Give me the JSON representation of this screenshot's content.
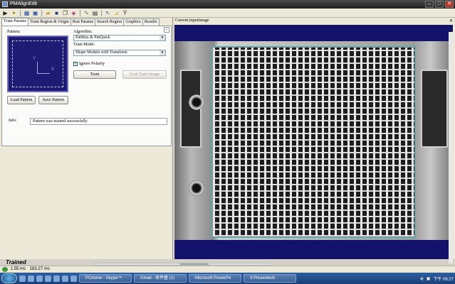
{
  "window": {
    "title": "PMAlignEdit",
    "minimize": "–",
    "maximize": "□",
    "close": "✕"
  },
  "toolbar": {
    "icons": [
      "play-icon",
      "magic-wand-icon",
      "grid-icon",
      "image-icon",
      "open-icon",
      "save-icon",
      "copy-icon",
      "layers-icon",
      "paint-icon",
      "text-icon",
      "cursor-icon",
      "chart-icon",
      "tune-icon"
    ]
  },
  "tabs": [
    {
      "label": "Train Params",
      "active": true
    },
    {
      "label": "Train Region & Origin",
      "active": false
    },
    {
      "label": "Run Params",
      "active": false
    },
    {
      "label": "Search Region",
      "active": false
    },
    {
      "label": "Graphics",
      "active": false
    },
    {
      "label": "Results",
      "active": false
    }
  ],
  "train": {
    "pin_glyph": "▫",
    "pattern_label": "Pattern:",
    "axis_x": "X",
    "axis_y": "Y",
    "algorithm_label": "Algorithm:",
    "algorithm_value": "PatMax & PatQuick",
    "train_mode_label": "Train Mode:",
    "train_mode_value": "Shape Models with Transform",
    "ignore_polarity_label": "Ignore Polarity",
    "ignore_polarity_checked": true,
    "train_button": "Train",
    "grab_train_button": "Grab Train Image",
    "load_button": "Load Pattern",
    "save_button": "Save Pattern",
    "info_label": "Info:",
    "info_value": "Pattern was trained successfully",
    "dropdown_glyph": "▾"
  },
  "status": {
    "trained": "Trained",
    "time_1": "1.55 ms",
    "time_2": "183.27 ms"
  },
  "image_view": {
    "title": "Current.InputImage",
    "close": "✕"
  },
  "taskbar": {
    "tasks": [
      "PChome - Skype™",
      "Gmail - 收件匣 (1)",
      "Microsoft PowerPo",
      "3 Presentech"
    ],
    "time": "下午 06:27"
  }
}
